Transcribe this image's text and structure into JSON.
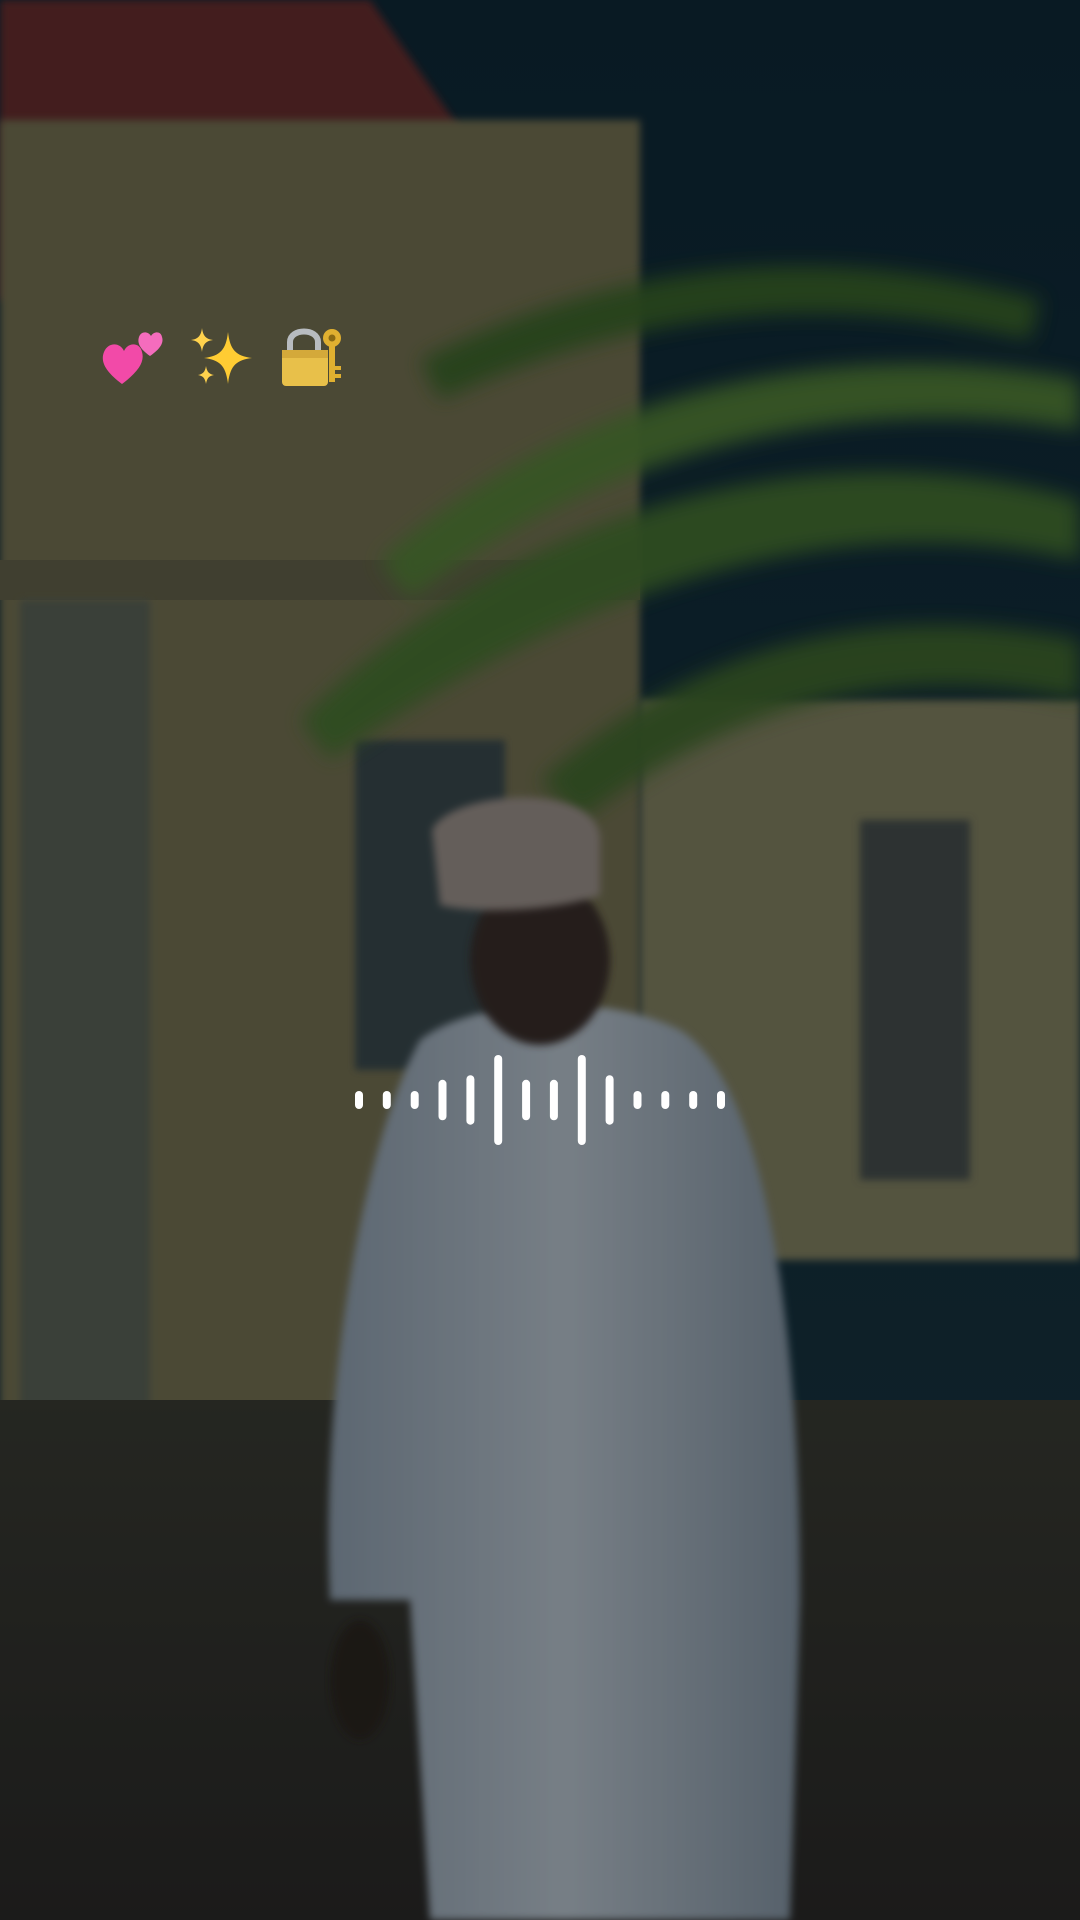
{
  "overlay": {
    "emojis": [
      "two-hearts-icon",
      "sparkles-icon",
      "locked-with-key-icon"
    ],
    "emoji_colors": {
      "hearts": "#f24aa8",
      "sparkles": "#ffcc33",
      "lock": "#e8c04a"
    },
    "waveform": {
      "bar_levels": [
        0.2,
        0.2,
        0.2,
        0.45,
        0.55,
        1.0,
        0.45,
        0.45,
        1.0,
        0.55,
        0.2,
        0.2,
        0.2,
        0.2
      ],
      "color": "#ffffff"
    }
  },
  "scene": {
    "description_colors": {
      "sky": "#0e2630",
      "wall": "#8a8458",
      "robe": "#d8dee2",
      "palm": "#4f7a2a",
      "roof": "#7a2f28"
    }
  }
}
